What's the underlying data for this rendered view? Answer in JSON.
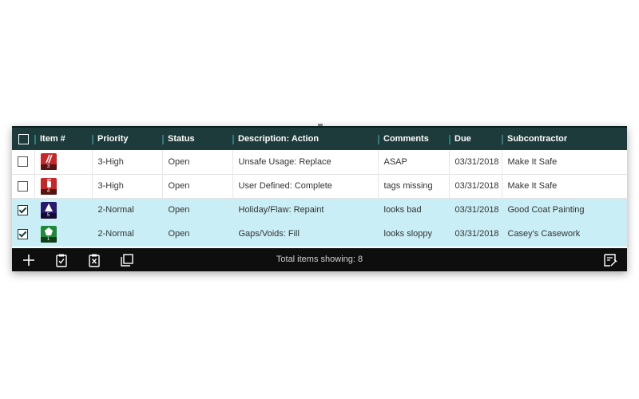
{
  "columns": [
    "Item #",
    "Priority",
    "Status",
    "Description: Action",
    "Comments",
    "Due",
    "Subcontractor"
  ],
  "rows": [
    {
      "item_number": "3",
      "item_color": "#c62828",
      "item_icon": "red-tag-icon",
      "selected": false,
      "priority": "3-High",
      "status": "Open",
      "description": "Unsafe Usage: Replace",
      "comments": "ASAP",
      "due": "03/31/2018",
      "subcontractor": "Make It Safe"
    },
    {
      "item_number": "4",
      "item_color": "#c62828",
      "item_icon": "fire-extinguisher-icon",
      "selected": false,
      "priority": "3-High",
      "status": "Open",
      "description": "User Defined: Complete",
      "comments": "tags missing",
      "due": "03/31/2018",
      "subcontractor": "Make It Safe"
    },
    {
      "item_number": "5",
      "item_color": "#2a1a6e",
      "item_icon": "triangle-marker-icon",
      "selected": true,
      "priority": "2-Normal",
      "status": "Open",
      "description": "Holiday/Flaw: Repaint",
      "comments": "looks bad",
      "due": "03/31/2018",
      "subcontractor": "Good Coat Painting"
    },
    {
      "item_number": "1",
      "item_color": "#1f8a3a",
      "item_icon": "pentagon-marker-icon",
      "selected": true,
      "priority": "2-Normal",
      "status": "Open",
      "description": "Gaps/Voids: Fill",
      "comments": "looks sloppy",
      "due": "03/31/2018",
      "subcontractor": "Casey's Casework"
    }
  ],
  "toolbar": {
    "total_label": "Total items showing: 8",
    "buttons": [
      "add-icon",
      "clipboard-check-icon",
      "clipboard-x-icon",
      "copy-icon",
      "edit-note-icon"
    ]
  },
  "colors": {
    "header_bg": "#1e3b3b",
    "selected_row_bg": "#c9eef5",
    "toolbar_bg": "#0e0e0e"
  }
}
